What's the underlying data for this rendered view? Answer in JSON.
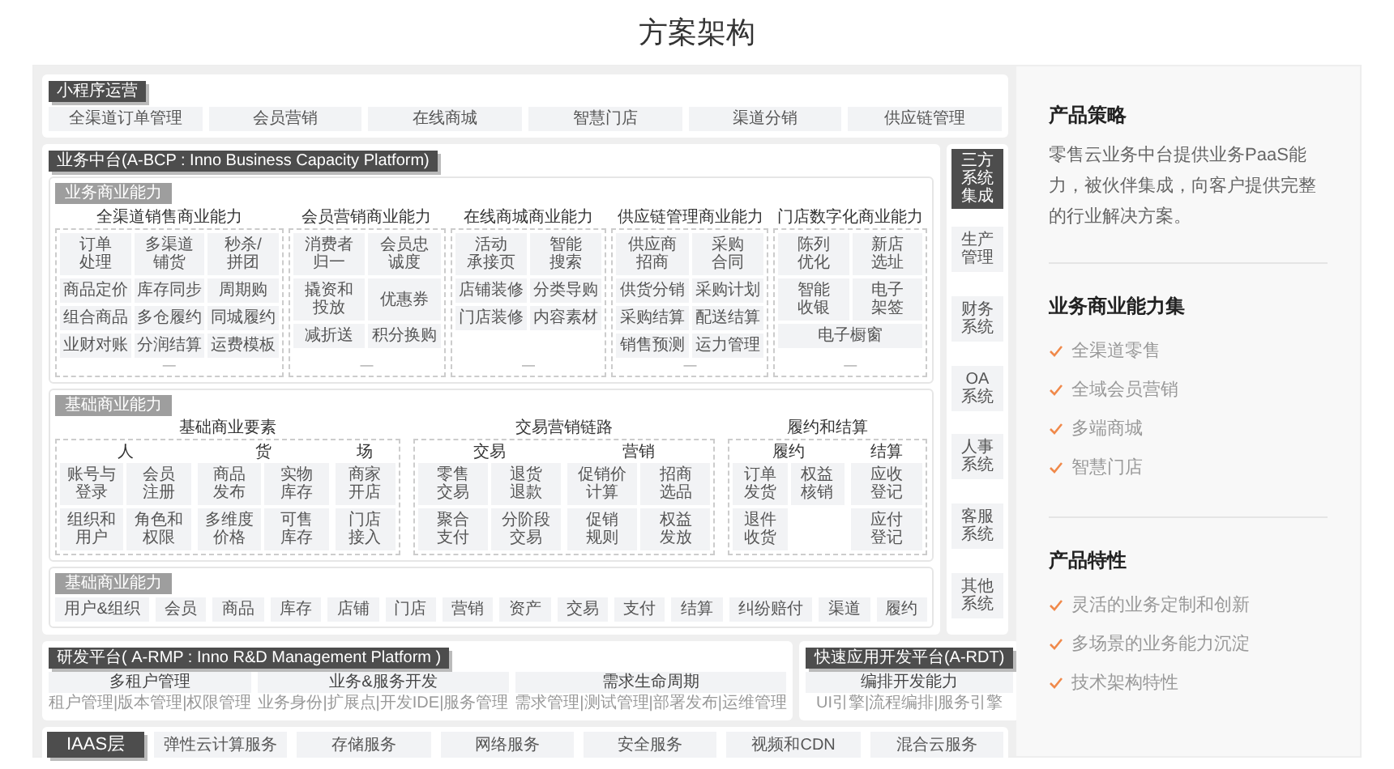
{
  "page_title": "方案架构",
  "diagram": {
    "mini_program": {
      "title": "小程序运营",
      "items": [
        "全渠道订单管理",
        "会员营销",
        "在线商城",
        "智慧门店",
        "渠道分销",
        "供应链管理"
      ]
    },
    "business_platform": {
      "title": "业务中台(A-BCP : Inno Business Capacity Platform)",
      "business_capability": {
        "title": "业务商业能力",
        "groups": [
          {
            "title": "全渠道销售商业能力",
            "rows": [
              [
                [
                  "订单",
                  "处理"
                ],
                [
                  "多渠道",
                  "铺货"
                ],
                [
                  "秒杀/",
                  "拼团"
                ]
              ],
              [
                "商品定价",
                "库存同步",
                "周期购"
              ],
              [
                "组合商品",
                "多仓履约",
                "同城履约"
              ],
              [
                "业财对账",
                "分润结算",
                "运费模板"
              ]
            ],
            "more": "—"
          },
          {
            "title": "会员营销商业能力",
            "rows": [
              [
                [
                  "消费者",
                  "归一"
                ],
                [
                  "会员忠",
                  "诚度"
                ]
              ],
              [
                [
                  "撬资和",
                  "投放"
                ],
                "优惠券"
              ],
              [
                "减折送",
                "积分换购"
              ]
            ],
            "more": "—"
          },
          {
            "title": "在线商城商业能力",
            "rows": [
              [
                [
                  "活动",
                  "承接页"
                ],
                [
                  "智能",
                  "搜索"
                ]
              ],
              [
                "店铺装修",
                "分类导购"
              ],
              [
                "门店装修",
                "内容素材"
              ]
            ],
            "more": "—"
          },
          {
            "title": "供应链管理商业能力",
            "rows": [
              [
                [
                  "供应商",
                  "招商"
                ],
                [
                  "采购",
                  "合同"
                ]
              ],
              [
                "供货分销",
                "采购计划"
              ],
              [
                "采购结算",
                "配送结算"
              ],
              [
                "销售预测",
                "运力管理"
              ]
            ],
            "more": "—"
          },
          {
            "title": "门店数字化商业能力",
            "rows": [
              [
                [
                  "陈列",
                  "优化"
                ],
                [
                  "新店",
                  "选址"
                ]
              ],
              [
                [
                  "智能",
                  "收银"
                ],
                [
                  "电子",
                  "架签"
                ]
              ],
              [
                "电子橱窗"
              ]
            ],
            "more": "—"
          }
        ]
      },
      "basic_capability": {
        "title": "基础商业能力",
        "parts": [
          {
            "title": "基础商业要素",
            "columns": [
              {
                "title": "人",
                "rows": [
                  [
                    [
                      "账号与",
                      "登录"
                    ],
                    [
                      "会员",
                      "注册"
                    ]
                  ],
                  [
                    [
                      "组织和",
                      "用户"
                    ],
                    [
                      "角色和",
                      "权限"
                    ]
                  ]
                ]
              },
              {
                "title": "货",
                "rows": [
                  [
                    [
                      "商品",
                      "发布"
                    ],
                    [
                      "实物",
                      "库存"
                    ]
                  ],
                  [
                    [
                      "多维度",
                      "价格"
                    ],
                    [
                      "可售",
                      "库存"
                    ]
                  ]
                ]
              },
              {
                "title": "场",
                "rows": [
                  [
                    [
                      "商家",
                      "开店"
                    ]
                  ],
                  [
                    [
                      "门店",
                      "接入"
                    ]
                  ]
                ]
              }
            ]
          },
          {
            "title": "交易营销链路",
            "columns": [
              {
                "title": "交易",
                "rows": [
                  [
                    [
                      "零售",
                      "交易"
                    ],
                    [
                      "退货",
                      "退款"
                    ]
                  ],
                  [
                    [
                      "聚合",
                      "支付"
                    ],
                    [
                      "分阶段",
                      "交易"
                    ]
                  ]
                ]
              },
              {
                "title": "营销",
                "rows": [
                  [
                    [
                      "促销价",
                      "计算"
                    ],
                    [
                      "招商",
                      "选品"
                    ]
                  ],
                  [
                    [
                      "促销",
                      "规则"
                    ],
                    [
                      "权益",
                      "发放"
                    ]
                  ]
                ]
              }
            ]
          },
          {
            "title": "履约和结算",
            "columns": [
              {
                "title": "履约",
                "rows": [
                  [
                    [
                      "订单",
                      "发货"
                    ],
                    [
                      "权益",
                      "核销"
                    ]
                  ],
                  [
                    [
                      "退件",
                      "收货"
                    ]
                  ]
                ]
              },
              {
                "title": "结算",
                "rows": [
                  [
                    [
                      "应收",
                      "登记"
                    ]
                  ],
                  [
                    [
                      "应付",
                      "登记"
                    ]
                  ]
                ]
              }
            ]
          }
        ]
      },
      "basic_bar": {
        "title": "基础商业能力",
        "items": [
          "用户&组织",
          "会员",
          "商品",
          "库存",
          "店铺",
          "门店",
          "营销",
          "资产",
          "交易",
          "支付",
          "结算",
          "纠纷赔付",
          "渠道",
          "履约"
        ]
      }
    },
    "third_party": {
      "title": [
        "三方",
        "系统",
        "集成"
      ],
      "items": [
        [
          "生产",
          "管理"
        ],
        [
          "财务",
          "系统"
        ],
        [
          "OA",
          "系统"
        ],
        [
          "人事",
          "系统"
        ],
        [
          "客服",
          "系统"
        ],
        [
          "其他",
          "系统"
        ]
      ]
    },
    "rnd_platform": {
      "title": "研发平台( A-RMP : Inno R&D Management Platform )",
      "columns": [
        {
          "title": "多租户管理",
          "detail": "租户管理|版本管理|权限管理"
        },
        {
          "title": "业务&服务开发",
          "detail": "业务身份|扩展点|开发IDE|服务管理"
        },
        {
          "title": "需求生命周期",
          "detail": "需求管理|测试管理|部署发布|运维管理"
        }
      ]
    },
    "rdt_platform": {
      "title": "快速应用开发平台(A-RDT)",
      "columns": [
        {
          "title": "编排开发能力",
          "detail": "UI引擎|流程编排|服务引擎"
        }
      ]
    },
    "iaas": {
      "title": "IAAS层",
      "items": [
        "弹性云计算服务",
        "存储服务",
        "网络服务",
        "安全服务",
        "视频和CDN",
        "混合云服务"
      ]
    }
  },
  "panel": {
    "sections": [
      {
        "title": "产品策略",
        "text": "零售云业务中台提供业务PaaS能力，被伙伴集成，向客户提供完整的行业解决方案。"
      },
      {
        "title": "业务商业能力集",
        "items": [
          "全渠道零售",
          "全域会员营销",
          "多端商城",
          "智慧门店"
        ]
      },
      {
        "title": "产品特性",
        "items": [
          "灵活的业务定制和创新",
          "多场景的业务能力沉淀",
          "技术架构特性"
        ]
      }
    ]
  }
}
